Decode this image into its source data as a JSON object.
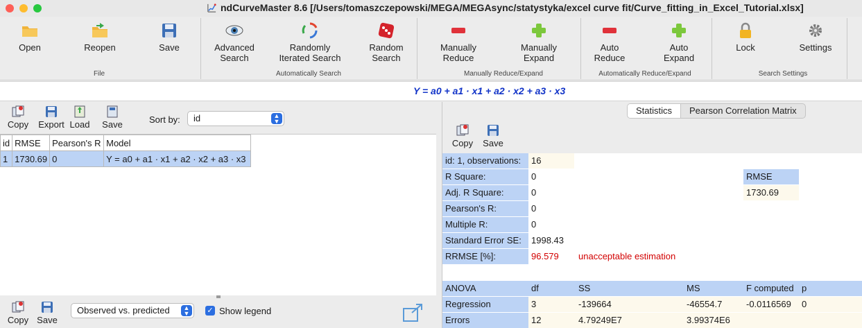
{
  "window": {
    "title": "ndCurveMaster 8.6 [/Users/tomaszczepowski/MEGA/MEGAsync/statystyka/excel curve fit/Curve_fitting_in_Excel_Tutorial.xlsx]"
  },
  "toolbar": {
    "open": "Open",
    "reopen": "Reopen",
    "save": "Save",
    "advanced_search_1": "Advanced",
    "advanced_search_2": "Search",
    "randomly_iterated_1": "Randomly",
    "randomly_iterated_2": "Iterated Search",
    "random_search_1": "Random",
    "random_search_2": "Search",
    "manually_reduce_1": "Manually",
    "manually_reduce_2": "Reduce",
    "manually_expand_1": "Manually",
    "manually_expand_2": "Expand",
    "auto_reduce_1": "Auto",
    "auto_reduce_2": "Reduce",
    "auto_expand_1": "Auto",
    "auto_expand_2": "Expand",
    "lock": "Lock",
    "settings": "Settings",
    "groups": {
      "file": "File",
      "auto_search": "Automatically Search",
      "manual_re": "Manually Reduce/Expand",
      "auto_re": "Automatically Reduce/Expand",
      "search_settings": "Search Settings"
    }
  },
  "equation": "Y = a0  + a1 · x1 + a2 · x2 + a3 · x3",
  "left": {
    "copy": "Copy",
    "export": "Export",
    "load": "Load",
    "save": "Save",
    "sort_by_label": "Sort by:",
    "sort_by_value": "id",
    "table": {
      "headers": [
        "id",
        "RMSE",
        "Pearson's R",
        "Model"
      ],
      "rows": [
        [
          "1",
          "1730.69",
          "0",
          "Y = a0  + a1 · x1 + a2 · x2 + a3 · x3"
        ]
      ]
    },
    "bottom": {
      "copy": "Copy",
      "save": "Save",
      "plot_select": "Observed vs. predicted",
      "show_legend": "Show legend"
    }
  },
  "right": {
    "tabs": [
      "Statistics",
      "Pearson Correlation Matrix"
    ],
    "copy": "Copy",
    "save": "Save",
    "stats": {
      "id_obs_label": "id: 1, observations:",
      "id_obs_value": "16",
      "r_square_label": "R Square:",
      "r_square_value": "0",
      "adj_r_square_label": "Adj. R Square:",
      "adj_r_square_value": "0",
      "pearson_label": "Pearson's R:",
      "pearson_value": "0",
      "multiple_r_label": "Multiple R:",
      "multiple_r_value": "0",
      "se_label": "Standard Error SE:",
      "se_value": "1998.43",
      "rrmse_label": "RRMSE [%]:",
      "rrmse_value": "96.579",
      "rrmse_note": "unacceptable estimation",
      "rmse_label": "RMSE",
      "rmse_value": "1730.69"
    },
    "anova": {
      "headers": [
        "ANOVA",
        "df",
        "SS",
        "MS",
        "F computed",
        "p"
      ],
      "rows": [
        [
          "Regression",
          "3",
          "-139664",
          "-46554.7",
          "-0.0116569",
          "0"
        ],
        [
          "Errors",
          "12",
          "4.79249E7",
          "3.99374E6",
          "",
          ""
        ]
      ]
    }
  },
  "colors": {
    "accent": "#2b6ee0",
    "equation": "#1234c8",
    "selection": "#bcd3f5",
    "error_text": "#d20000"
  }
}
